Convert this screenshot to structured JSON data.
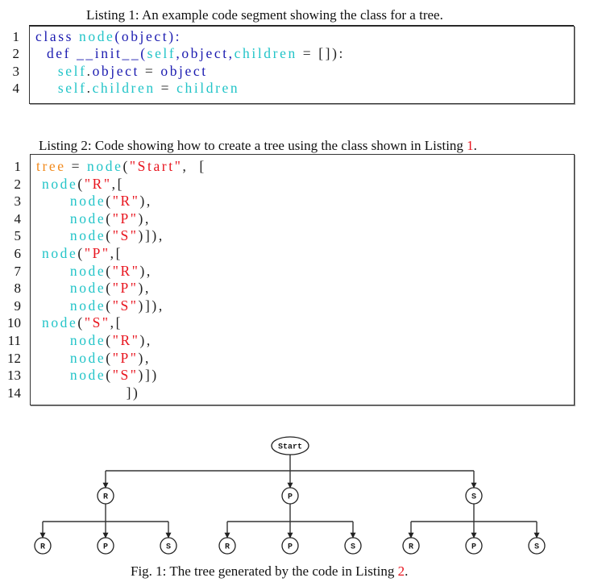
{
  "listing1": {
    "caption": "Listing 1: An example code segment showing the class for a tree.",
    "lines": [
      {
        "num": "1",
        "tokens": [
          {
            "t": "class ",
            "c": "kw"
          },
          {
            "t": "node",
            "c": "id"
          },
          {
            "t": "(",
            "c": "pun"
          },
          {
            "t": "object",
            "c": "kw"
          },
          {
            "t": "):",
            "c": "pun"
          }
        ]
      },
      {
        "num": "2",
        "tokens": [
          {
            "t": "  def ",
            "c": "kw"
          },
          {
            "t": "__init__",
            "c": "kw"
          },
          {
            "t": "(",
            "c": "pun"
          },
          {
            "t": "self",
            "c": "id"
          },
          {
            "t": ",",
            "c": "pun"
          },
          {
            "t": "object",
            "c": "kw"
          },
          {
            "t": ",",
            "c": "pun"
          },
          {
            "t": "children",
            "c": "id"
          },
          {
            "t": " = []):",
            "c": "pun2"
          }
        ]
      },
      {
        "num": "3",
        "tokens": [
          {
            "t": "    self",
            "c": "id"
          },
          {
            "t": ".",
            "c": "pun2"
          },
          {
            "t": "object",
            "c": "kw"
          },
          {
            "t": " = ",
            "c": "pun2"
          },
          {
            "t": "object",
            "c": "kw"
          }
        ]
      },
      {
        "num": "4",
        "tokens": [
          {
            "t": "    self",
            "c": "id"
          },
          {
            "t": ".",
            "c": "pun2"
          },
          {
            "t": "children",
            "c": "id"
          },
          {
            "t": " = ",
            "c": "pun2"
          },
          {
            "t": "children",
            "c": "id"
          }
        ]
      }
    ]
  },
  "listing2": {
    "caption_prefix": "Listing 2: Code showing how to create a tree using the class shown in Listing ",
    "caption_ref": "1",
    "caption_suffix": ".",
    "lines": [
      {
        "num": "1",
        "tokens": [
          {
            "t": "tree",
            "c": "var"
          },
          {
            "t": " = ",
            "c": "pun2"
          },
          {
            "t": "node",
            "c": "id"
          },
          {
            "t": "(",
            "c": "pun2"
          },
          {
            "t": "\"Start\"",
            "c": "str"
          },
          {
            "t": ",  [",
            "c": "pun2"
          }
        ]
      },
      {
        "num": "2",
        "tokens": [
          {
            "t": " node",
            "c": "id"
          },
          {
            "t": "(",
            "c": "pun2"
          },
          {
            "t": "\"R\"",
            "c": "str"
          },
          {
            "t": ",[",
            "c": "pun2"
          }
        ]
      },
      {
        "num": "3",
        "tokens": [
          {
            "t": "      node",
            "c": "id"
          },
          {
            "t": "(",
            "c": "pun2"
          },
          {
            "t": "\"R\"",
            "c": "str"
          },
          {
            "t": "),",
            "c": "pun2"
          }
        ]
      },
      {
        "num": "4",
        "tokens": [
          {
            "t": "      node",
            "c": "id"
          },
          {
            "t": "(",
            "c": "pun2"
          },
          {
            "t": "\"P\"",
            "c": "str"
          },
          {
            "t": "),",
            "c": "pun2"
          }
        ]
      },
      {
        "num": "5",
        "tokens": [
          {
            "t": "      node",
            "c": "id"
          },
          {
            "t": "(",
            "c": "pun2"
          },
          {
            "t": "\"S\"",
            "c": "str"
          },
          {
            "t": ")]),",
            "c": "pun2"
          }
        ]
      },
      {
        "num": "6",
        "tokens": [
          {
            "t": " node",
            "c": "id"
          },
          {
            "t": "(",
            "c": "pun2"
          },
          {
            "t": "\"P\"",
            "c": "str"
          },
          {
            "t": ",[",
            "c": "pun2"
          }
        ]
      },
      {
        "num": "7",
        "tokens": [
          {
            "t": "      node",
            "c": "id"
          },
          {
            "t": "(",
            "c": "pun2"
          },
          {
            "t": "\"R\"",
            "c": "str"
          },
          {
            "t": "),",
            "c": "pun2"
          }
        ]
      },
      {
        "num": "8",
        "tokens": [
          {
            "t": "      node",
            "c": "id"
          },
          {
            "t": "(",
            "c": "pun2"
          },
          {
            "t": "\"P\"",
            "c": "str"
          },
          {
            "t": "),",
            "c": "pun2"
          }
        ]
      },
      {
        "num": "9",
        "tokens": [
          {
            "t": "      node",
            "c": "id"
          },
          {
            "t": "(",
            "c": "pun2"
          },
          {
            "t": "\"S\"",
            "c": "str"
          },
          {
            "t": ")]),",
            "c": "pun2"
          }
        ]
      },
      {
        "num": "10",
        "tokens": [
          {
            "t": " node",
            "c": "id"
          },
          {
            "t": "(",
            "c": "pun2"
          },
          {
            "t": "\"S\"",
            "c": "str"
          },
          {
            "t": ",[",
            "c": "pun2"
          }
        ]
      },
      {
        "num": "11",
        "tokens": [
          {
            "t": "      node",
            "c": "id"
          },
          {
            "t": "(",
            "c": "pun2"
          },
          {
            "t": "\"R\"",
            "c": "str"
          },
          {
            "t": "),",
            "c": "pun2"
          }
        ]
      },
      {
        "num": "12",
        "tokens": [
          {
            "t": "      node",
            "c": "id"
          },
          {
            "t": "(",
            "c": "pun2"
          },
          {
            "t": "\"P\"",
            "c": "str"
          },
          {
            "t": "),",
            "c": "pun2"
          }
        ]
      },
      {
        "num": "13",
        "tokens": [
          {
            "t": "      node",
            "c": "id"
          },
          {
            "t": "(",
            "c": "pun2"
          },
          {
            "t": "\"S\"",
            "c": "str"
          },
          {
            "t": ")])",
            "c": "pun2"
          }
        ]
      },
      {
        "num": "14",
        "tokens": [
          {
            "t": "                ])",
            "c": "pun2"
          }
        ]
      }
    ]
  },
  "figure": {
    "caption_prefix": "Fig. 1: The tree generated by the code in Listing ",
    "caption_ref": "2",
    "caption_suffix": ".",
    "tree": {
      "label": "Start",
      "children": [
        {
          "label": "R",
          "children": [
            {
              "label": "R"
            },
            {
              "label": "P"
            },
            {
              "label": "S"
            }
          ]
        },
        {
          "label": "P",
          "children": [
            {
              "label": "R"
            },
            {
              "label": "P"
            },
            {
              "label": "S"
            }
          ]
        },
        {
          "label": "S",
          "children": [
            {
              "label": "R"
            },
            {
              "label": "P"
            },
            {
              "label": "S"
            }
          ]
        }
      ]
    }
  },
  "colors": {
    "keyword": "#1b1bb0",
    "identifier": "#22c4c8",
    "string": "#e8141e",
    "variable": "#f28a1c",
    "reference": "#e8141e"
  }
}
